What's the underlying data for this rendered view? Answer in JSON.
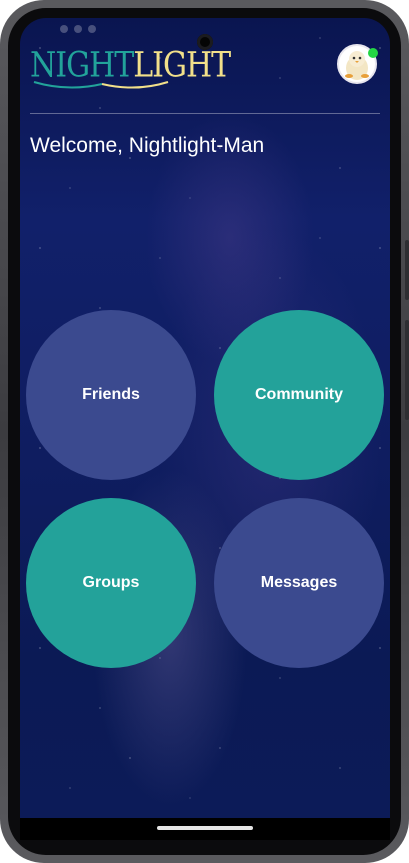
{
  "app": {
    "logo_part_1": "NIGHT",
    "logo_part_2": "LIGHT",
    "welcome_text": "Welcome, Nightlight-Man"
  },
  "menu": {
    "friends": "Friends",
    "community": "Community",
    "groups": "Groups",
    "messages": "Messages"
  },
  "colors": {
    "indigo_button": "#3b4a8f",
    "teal_button": "#23a29a",
    "logo_teal": "#22a39a",
    "logo_yellow": "#f2e08a",
    "online_status": "#24d645",
    "background": "#0f1d60"
  },
  "icons": {
    "avatar": "penguin-avatar-icon",
    "online": "online-status-dot"
  }
}
